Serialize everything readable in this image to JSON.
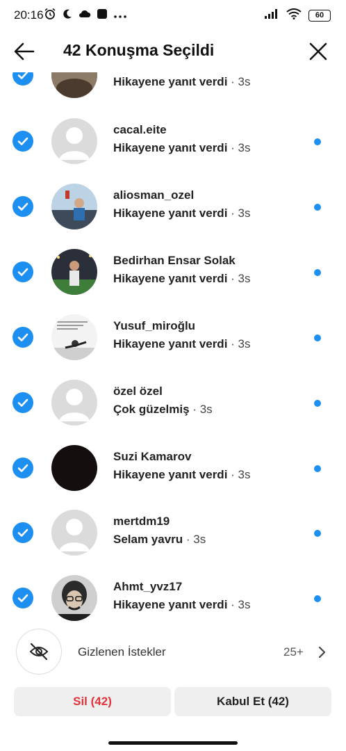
{
  "status_bar": {
    "time": "20:16",
    "battery": "60"
  },
  "header": {
    "title": "42 Konuşma Seçildi"
  },
  "conversations": [
    {
      "name": "",
      "message": "Hikayene yanıt verdi",
      "time": "· 3s"
    },
    {
      "name": "cacal.eite",
      "message": "Hikayene yanıt verdi",
      "time": "· 3s"
    },
    {
      "name": "aliosman_ozel",
      "message": "Hikayene yanıt verdi",
      "time": "· 3s"
    },
    {
      "name": "Bedirhan Ensar Solak",
      "message": "Hikayene yanıt verdi",
      "time": "· 3s"
    },
    {
      "name": "Yusuf_miroğlu",
      "message": "Hikayene yanıt verdi",
      "time": "· 3s"
    },
    {
      "name": "özel özel",
      "message": "Çok güzelmiş",
      "time": "· 3s"
    },
    {
      "name": "Suzi Kamarov",
      "message": "Hikayene yanıt verdi",
      "time": "· 3s"
    },
    {
      "name": "mertdm19",
      "message": "Selam yavru",
      "time": "· 3s"
    },
    {
      "name": "Ahmt_yvz17",
      "message": "Hikayene yanıt verdi",
      "time": "· 3s"
    }
  ],
  "hidden_requests": {
    "label": "Gizlenen İstekler",
    "count": "25+"
  },
  "actions": {
    "delete_label": "Sil (42)",
    "accept_label": "Kabul Et (42)"
  },
  "colors": {
    "accent": "#1d8ff0",
    "danger": "#e0333a"
  }
}
